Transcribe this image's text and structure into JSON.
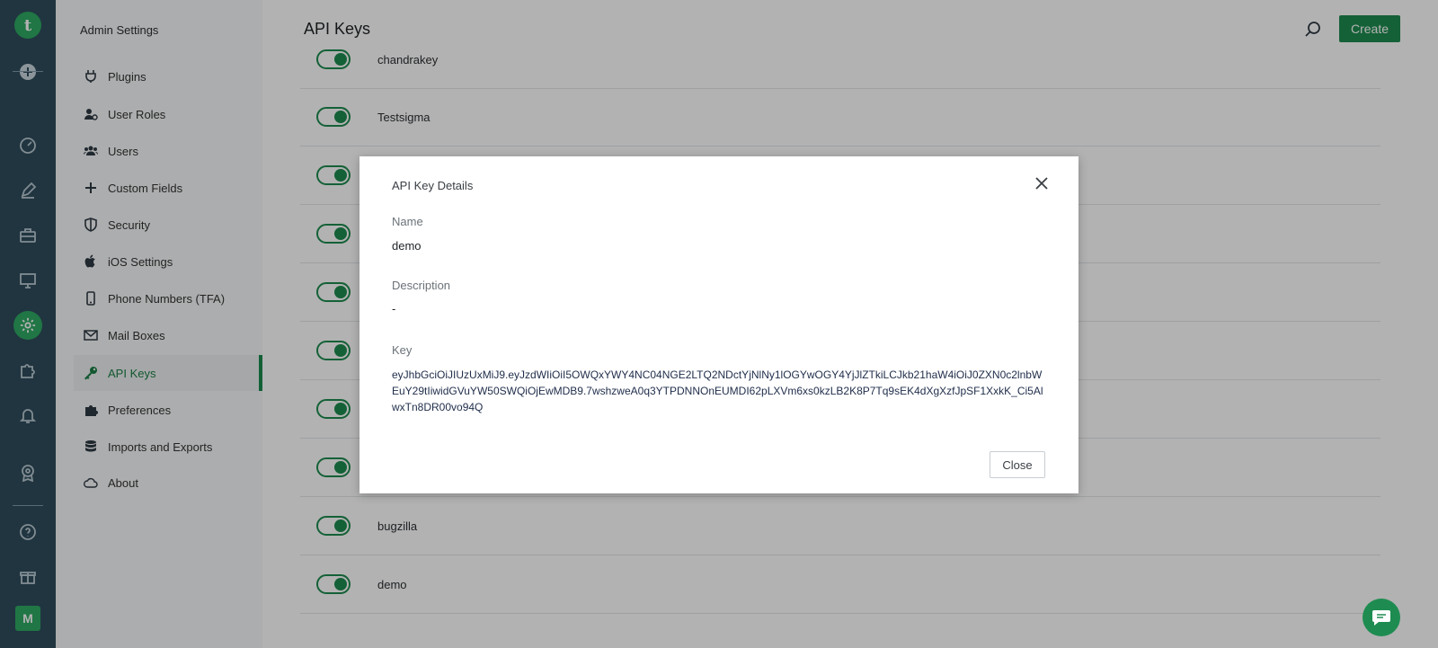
{
  "rail": {
    "avatar_letter": "M"
  },
  "sidebar": {
    "title": "Admin Settings",
    "items": [
      {
        "label": "Plugins",
        "icon": "plug-icon"
      },
      {
        "label": "User Roles",
        "icon": "user-roles-icon"
      },
      {
        "label": "Users",
        "icon": "users-icon"
      },
      {
        "label": "Custom Fields",
        "icon": "plus-icon"
      },
      {
        "label": "Security",
        "icon": "shield-icon"
      },
      {
        "label": "iOS Settings",
        "icon": "apple-icon"
      },
      {
        "label": "Phone Numbers (TFA)",
        "icon": "phone-icon"
      },
      {
        "label": "Mail Boxes",
        "icon": "mail-icon"
      },
      {
        "label": "API Keys",
        "icon": "key-icon",
        "active": true
      },
      {
        "label": "Preferences",
        "icon": "puzzle-icon"
      },
      {
        "label": "Imports and Exports",
        "icon": "database-icon"
      },
      {
        "label": "About",
        "icon": "cloud-icon"
      }
    ]
  },
  "header": {
    "title": "API Keys",
    "create_label": "Create"
  },
  "api_keys": {
    "rows": [
      {
        "name": "chandrakey",
        "enabled": true
      },
      {
        "name": "Testsigma",
        "enabled": true
      },
      {
        "name": "",
        "enabled": true
      },
      {
        "name": "",
        "enabled": true
      },
      {
        "name": "",
        "enabled": true
      },
      {
        "name": "",
        "enabled": true
      },
      {
        "name": "",
        "enabled": true
      },
      {
        "name": "",
        "enabled": true
      },
      {
        "name": "bugzilla",
        "enabled": true
      },
      {
        "name": "demo",
        "enabled": true
      }
    ]
  },
  "modal": {
    "title": "API Key Details",
    "name_label": "Name",
    "name_value": "demo",
    "description_label": "Description",
    "description_value": "-",
    "key_label": "Key",
    "key_value": "eyJhbGciOiJIUzUxMiJ9.eyJzdWIiOiI5OWQxYWY4NC04NGE2LTQ2NDctYjNlNy1lOGYwOGY4YjJlZTkiLCJkb21haW4iOiJ0ZXN0c2lnbWEuY29tIiwidGVuYW50SWQiOjEwMDB9.7wshzweA0q3YTPDNNOnEUMDI62pLXVm6xs0kzLB2K8P7Tq9sEK4dXgXzfJpSF1XxkK_Ci5AlwxTn8DR00vo94Q",
    "close_label": "Close"
  },
  "colors": {
    "brand_green": "#1e8c50",
    "rail_bg": "#2e4c5c"
  }
}
